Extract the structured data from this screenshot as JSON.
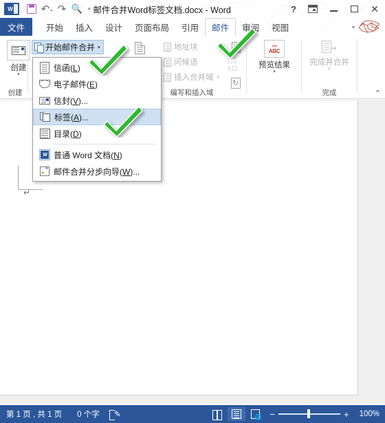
{
  "window": {
    "title": "邮件合并Word标签文档.docx - Word",
    "quick_access": {
      "save": "save-icon",
      "undo": "undo-icon",
      "redo": "redo-icon",
      "print_preview": "print-preview-icon",
      "customize": "customize-quick-access-icon"
    },
    "controls": {
      "help": "?",
      "ribbon_display": "ribbon-display-options",
      "minimize": "minimize",
      "maximize": "maximize",
      "close": "✕"
    }
  },
  "tabs": {
    "file": "文件",
    "items": [
      {
        "label": "开始",
        "active": false
      },
      {
        "label": "插入",
        "active": false
      },
      {
        "label": "设计",
        "active": false
      },
      {
        "label": "页面布局",
        "active": false
      },
      {
        "label": "引用",
        "active": false
      },
      {
        "label": "邮件",
        "active": true
      },
      {
        "label": "审阅",
        "active": false
      },
      {
        "label": "视图",
        "active": false
      }
    ]
  },
  "ribbon": {
    "groups": [
      {
        "label": "创建"
      },
      {
        "label": "编写和插入域"
      },
      {
        "label": "完成"
      }
    ],
    "create": {
      "button_label": "创建",
      "caret": "▾"
    },
    "start_mail_merge": {
      "label": "开始邮件合并",
      "caret": "▾",
      "highlighted": true
    },
    "write_insert": {
      "items": [
        {
          "label": "地址块",
          "disabled": true
        },
        {
          "label": "问候语",
          "disabled": true
        },
        {
          "label": "插入合并域",
          "disabled": true,
          "caret": "▾"
        }
      ]
    },
    "preview": {
      "label": "预览结果",
      "icon_text": "ABC",
      "icon_chevrons": "«»",
      "caret": "▾"
    },
    "finish": {
      "label": "完成并合并",
      "caret": "▾",
      "disabled": true
    },
    "collapse": "⌃"
  },
  "menu": {
    "items": [
      {
        "label_prefix": "信函(",
        "key": "L",
        "label_suffix": ")",
        "icon": "letter-icon",
        "selected": false
      },
      {
        "label_prefix": "电子邮件(",
        "key": "E",
        "label_suffix": ")",
        "icon": "email-icon",
        "selected": false
      },
      {
        "label_prefix": "信封(",
        "key": "V",
        "label_suffix": ")...",
        "icon": "envelope-icon",
        "selected": false
      },
      {
        "label_prefix": "标签(",
        "key": "A",
        "label_suffix": ")...",
        "icon": "labels-icon",
        "selected": true
      },
      {
        "label_prefix": "目录(",
        "key": "D",
        "label_suffix": ")",
        "icon": "directory-icon",
        "selected": false
      },
      {
        "label_prefix": "普通 Word 文档(",
        "key": "N",
        "label_suffix": ")",
        "icon": "word-document-icon",
        "selected": false
      },
      {
        "label_prefix": "邮件合并分步向导(",
        "key": "W",
        "label_suffix": ")...",
        "icon": "mail-merge-wizard-icon",
        "selected": false
      }
    ]
  },
  "document": {
    "paragraph_mark": "↵"
  },
  "statusbar": {
    "page_info": "第 1 页 , 共 1 页",
    "word_count": "0 个字",
    "proofing": "proofing-icon",
    "views": [
      {
        "name": "read-mode",
        "active": false
      },
      {
        "name": "print-layout",
        "active": true
      },
      {
        "name": "web-layout",
        "active": false
      }
    ],
    "zoom_out": "−",
    "zoom_in": "+",
    "zoom_level": "100%"
  },
  "annotations": {
    "checkmarks": 3,
    "color": "#2eb82e"
  },
  "colors": {
    "accent": "#2b579a",
    "highlight": "#cfe0f2",
    "checkmark": "#2eb82e"
  }
}
